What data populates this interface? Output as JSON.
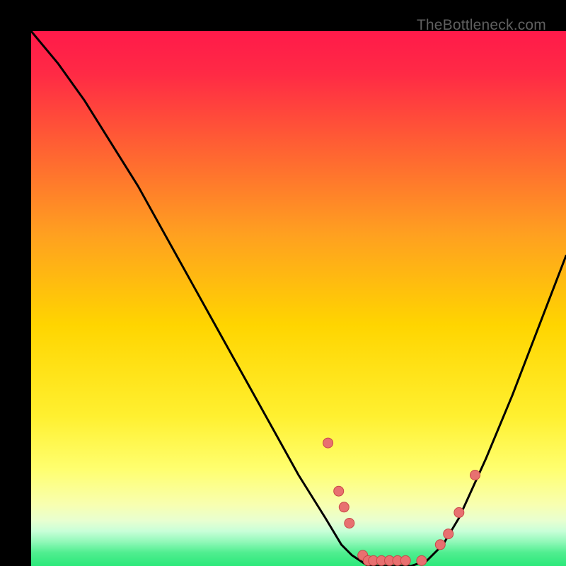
{
  "watermark": "TheBottleneck.com",
  "colors": {
    "bg": "#000000",
    "gradient_top": "#FF1A4A",
    "gradient_mid1": "#FF6A2A",
    "gradient_mid2": "#FFD500",
    "gradient_mid3": "#FFFF66",
    "gradient_bot": "#2CE87A",
    "curve": "#000000",
    "dot_fill": "#E87070",
    "dot_stroke": "#C84848",
    "watermark": "#5F5F5F"
  },
  "chart_data": {
    "type": "line",
    "title": "",
    "xlabel": "",
    "ylabel": "",
    "xlim": [
      0,
      100
    ],
    "ylim": [
      0,
      100
    ],
    "curve": [
      {
        "x": 0,
        "y": 100
      },
      {
        "x": 5,
        "y": 94
      },
      {
        "x": 10,
        "y": 87
      },
      {
        "x": 15,
        "y": 79
      },
      {
        "x": 20,
        "y": 71
      },
      {
        "x": 25,
        "y": 62
      },
      {
        "x": 30,
        "y": 53
      },
      {
        "x": 35,
        "y": 44
      },
      {
        "x": 40,
        "y": 35
      },
      {
        "x": 45,
        "y": 26
      },
      {
        "x": 50,
        "y": 17
      },
      {
        "x": 55,
        "y": 9
      },
      {
        "x": 58,
        "y": 4
      },
      {
        "x": 60,
        "y": 2
      },
      {
        "x": 63,
        "y": 0
      },
      {
        "x": 67,
        "y": 0
      },
      {
        "x": 71,
        "y": 0
      },
      {
        "x": 74,
        "y": 1
      },
      {
        "x": 77,
        "y": 4
      },
      {
        "x": 80,
        "y": 9
      },
      {
        "x": 85,
        "y": 20
      },
      {
        "x": 90,
        "y": 32
      },
      {
        "x": 95,
        "y": 45
      },
      {
        "x": 100,
        "y": 58
      }
    ],
    "dots": [
      {
        "x": 55.5,
        "y": 23
      },
      {
        "x": 57.5,
        "y": 14
      },
      {
        "x": 58.5,
        "y": 11
      },
      {
        "x": 59.5,
        "y": 8
      },
      {
        "x": 62,
        "y": 2
      },
      {
        "x": 63,
        "y": 1
      },
      {
        "x": 64,
        "y": 1
      },
      {
        "x": 65.5,
        "y": 1
      },
      {
        "x": 67,
        "y": 1
      },
      {
        "x": 68.5,
        "y": 1
      },
      {
        "x": 70,
        "y": 1
      },
      {
        "x": 73,
        "y": 1
      },
      {
        "x": 76.5,
        "y": 4
      },
      {
        "x": 78,
        "y": 6
      },
      {
        "x": 80,
        "y": 10
      },
      {
        "x": 83,
        "y": 17
      }
    ]
  }
}
